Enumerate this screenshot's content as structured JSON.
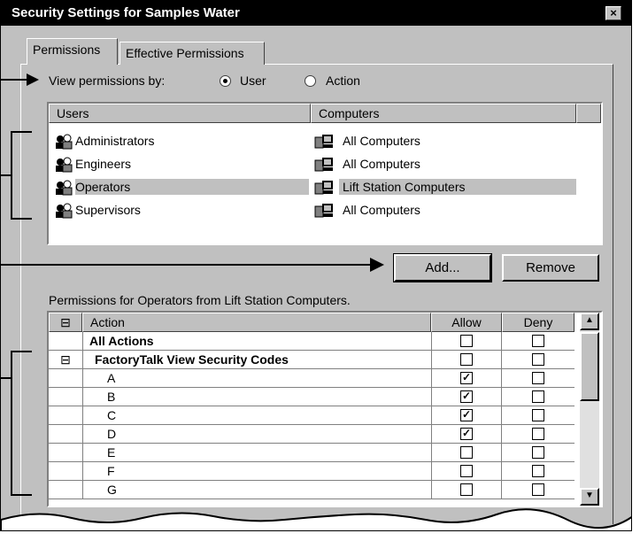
{
  "window": {
    "title": "Security Settings for Samples Water",
    "close_label": "×"
  },
  "tabs": [
    {
      "label": "Permissions"
    },
    {
      "label": "Effective Permissions"
    }
  ],
  "view_by": {
    "label": "View permissions by:",
    "options": [
      {
        "label": "User",
        "selected": true
      },
      {
        "label": "Action",
        "selected": false
      }
    ]
  },
  "users_list": {
    "headers": {
      "users": "Users",
      "computers": "Computers"
    },
    "rows": [
      {
        "user": "Administrators",
        "computer": "All Computers",
        "selected": false
      },
      {
        "user": "Engineers",
        "computer": "All Computers",
        "selected": false
      },
      {
        "user": "Operators",
        "computer": "Lift Station Computers",
        "selected": true
      },
      {
        "user": "Supervisors",
        "computer": "All Computers",
        "selected": false
      }
    ]
  },
  "buttons": {
    "add": "Add...",
    "remove": "Remove"
  },
  "permissions": {
    "caption": "Permissions for Operators from Lift Station Computers.",
    "headers": {
      "expand": "⊟",
      "action": "Action",
      "allow": "Allow",
      "deny": "Deny"
    },
    "rows": [
      {
        "expander": "",
        "action": "All Actions",
        "bold": true,
        "allow": false,
        "deny": false
      },
      {
        "expander": "⊟",
        "action": "FactoryTalk View Security Codes",
        "bold": true,
        "allow": false,
        "deny": false
      },
      {
        "expander": "",
        "action": "A",
        "bold": false,
        "allow": true,
        "deny": false
      },
      {
        "expander": "",
        "action": "B",
        "bold": false,
        "allow": true,
        "deny": false
      },
      {
        "expander": "",
        "action": "C",
        "bold": false,
        "allow": true,
        "deny": false
      },
      {
        "expander": "",
        "action": "D",
        "bold": false,
        "allow": true,
        "deny": false
      },
      {
        "expander": "",
        "action": "E",
        "bold": false,
        "allow": false,
        "deny": false
      },
      {
        "expander": "",
        "action": "F",
        "bold": false,
        "allow": false,
        "deny": false
      },
      {
        "expander": "",
        "action": "G",
        "bold": false,
        "allow": false,
        "deny": false
      }
    ]
  },
  "check_mark": "✓",
  "icons": {
    "user": "user-group-icon",
    "computer": "computer-icon"
  }
}
